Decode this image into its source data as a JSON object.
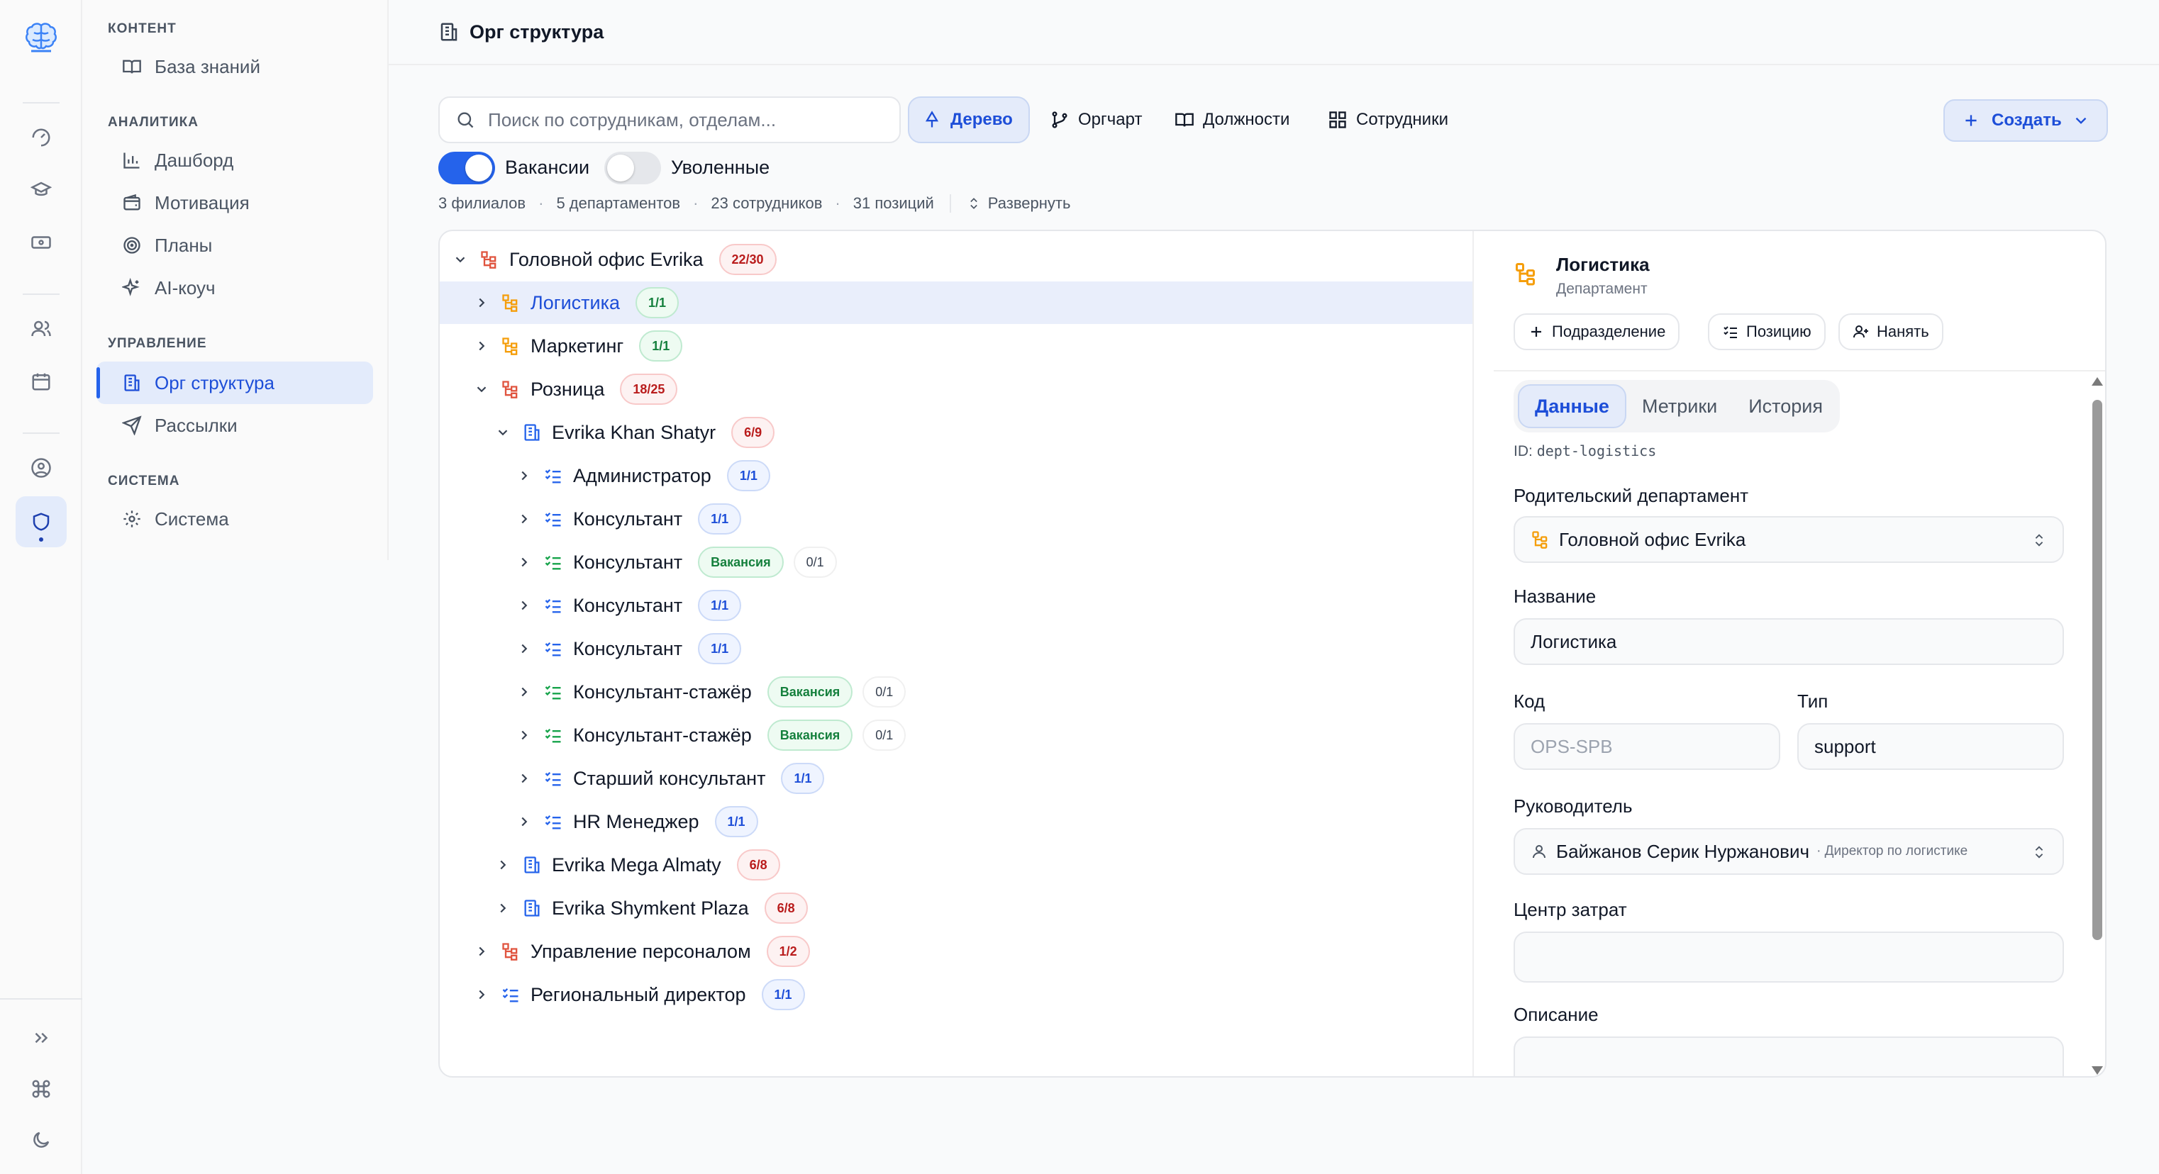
{
  "nav": {
    "sections": {
      "content": "КОНТЕНТ",
      "analytics": "АНАЛИТИКА",
      "management": "УПРАВЛЕНИЕ",
      "system": "СИСТЕМА"
    },
    "items": {
      "knowledge_base": "База знаний",
      "dashboard": "Дашборд",
      "motivation": "Мотивация",
      "plans": "Планы",
      "ai_coach": "AI-коуч",
      "org_structure": "Орг структура",
      "mailings": "Рассылки",
      "system": "Система"
    }
  },
  "header": {
    "title": "Орг структура"
  },
  "toolbar": {
    "search_placeholder": "Поиск по сотрудникам, отделам...",
    "tabs": {
      "tree": "Дерево",
      "orgchart": "Оргчарт",
      "positions": "Должности",
      "employees": "Сотрудники"
    },
    "create": "Создать"
  },
  "filters": {
    "vacancies": "Вакансии",
    "vacancies_on": true,
    "fired": "Уволенные",
    "fired_on": false
  },
  "stats": {
    "branches": "3 филиалов",
    "departments": "5 департаментов",
    "employees": "23 сотрудников",
    "positions": "31 позиций",
    "expand": "Развернуть"
  },
  "tree": {
    "rows": [
      {
        "label": "Головной офис Evrika",
        "badge": "22/30"
      },
      {
        "label": "Логистика",
        "badge": "1/1"
      },
      {
        "label": "Маркетинг",
        "badge": "1/1"
      },
      {
        "label": "Розница",
        "badge": "18/25"
      },
      {
        "label": "Evrika Khan Shatyr",
        "badge": "6/9"
      },
      {
        "label": "Администратор",
        "badge": "1/1"
      },
      {
        "label": "Консультант",
        "badge": "1/1"
      },
      {
        "label": "Консультант",
        "badge": "Вакансия",
        "extra": "0/1"
      },
      {
        "label": "Консультант",
        "badge": "1/1"
      },
      {
        "label": "Консультант",
        "badge": "1/1"
      },
      {
        "label": "Консультант-стажёр",
        "badge": "Вакансия",
        "extra": "0/1"
      },
      {
        "label": "Консультант-стажёр",
        "badge": "Вакансия",
        "extra": "0/1"
      },
      {
        "label": "Старший консультант",
        "badge": "1/1"
      },
      {
        "label": "HR Менеджер",
        "badge": "1/1"
      },
      {
        "label": "Evrika Mega Almaty",
        "badge": "6/8"
      },
      {
        "label": "Evrika Shymkent Plaza",
        "badge": "6/8"
      },
      {
        "label": "Управление персоналом",
        "badge": "1/2"
      },
      {
        "label": "Региональный директор",
        "badge": "1/1"
      }
    ]
  },
  "detail": {
    "title": "Логистика",
    "subtitle": "Департамент",
    "actions": {
      "subdivision": "Подразделение",
      "position": "Позицию",
      "hire": "Нанять"
    },
    "tabs": {
      "data": "Данные",
      "metrics": "Метрики",
      "history": "История"
    },
    "id_label": "ID:",
    "id_value": "dept-logistics",
    "fields": {
      "parent_label": "Родительский департамент",
      "parent_value": "Головной офис Evrika",
      "name_label": "Название",
      "name_value": "Логистика",
      "code_label": "Код",
      "code_placeholder": "OPS-SPB",
      "type_label": "Тип",
      "type_value": "support",
      "head_label": "Руководитель",
      "head_value": "Байжанов Серик Нуржанович",
      "head_hint": "· Директор по логистике",
      "cost_center_label": "Центр затрат",
      "description_label": "Описание"
    }
  }
}
